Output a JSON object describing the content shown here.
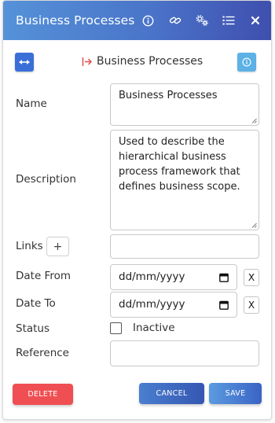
{
  "header": {
    "title": "Business Processes",
    "icons": [
      "info-icon",
      "link-icon",
      "settings-icon",
      "list-icon",
      "close-icon"
    ]
  },
  "toolbar": {
    "breadcrumb": "Business Processes"
  },
  "form": {
    "name_label": "Name",
    "name_value": "Business Processes",
    "description_label": "Description",
    "description_value": "Used to describe the hierarchical business process framework that defines business scope.",
    "links_label": "Links",
    "links_add": "+",
    "links_value": "",
    "date_from_label": "Date From",
    "date_from_placeholder": "dd/mm/yyyy",
    "date_to_label": "Date To",
    "date_to_placeholder": "dd/mm/yyyy",
    "clear_label": "X",
    "status_label": "Status",
    "status_option": "Inactive",
    "status_checked": false,
    "reference_label": "Reference",
    "reference_value": ""
  },
  "actions": {
    "delete": "DELETE",
    "cancel": "CANCEL",
    "save": "SAVE"
  },
  "colors": {
    "header_start": "#5592d8",
    "header_end": "#3f4fae",
    "delete": "#ef4f52",
    "accent": "#3b6fd8",
    "info": "#5cb1e6"
  }
}
